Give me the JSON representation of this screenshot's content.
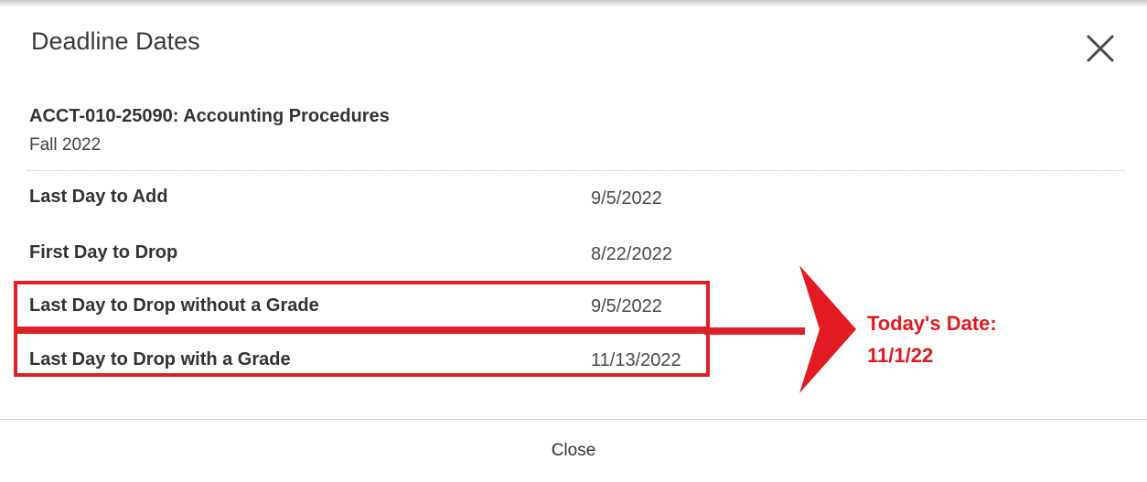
{
  "modal": {
    "title": "Deadline Dates",
    "close_icon": "close-icon",
    "footer_close_label": "Close"
  },
  "course": {
    "title": "ACCT-010-25090: Accounting Procedures",
    "term": "Fall 2022"
  },
  "deadlines": [
    {
      "label": "Last Day to Add",
      "date": "9/5/2022",
      "highlighted": false
    },
    {
      "label": "First Day to Drop",
      "date": "8/22/2022",
      "highlighted": false
    },
    {
      "label": "Last Day to Drop without a Grade",
      "date": "9/5/2022",
      "highlighted": true
    },
    {
      "label": "Last Day to Drop with a Grade",
      "date": "11/13/2022",
      "highlighted": true
    }
  ],
  "annotation": {
    "line1": "Today's Date:",
    "line2": "11/1/22",
    "color": "#e21b23"
  }
}
